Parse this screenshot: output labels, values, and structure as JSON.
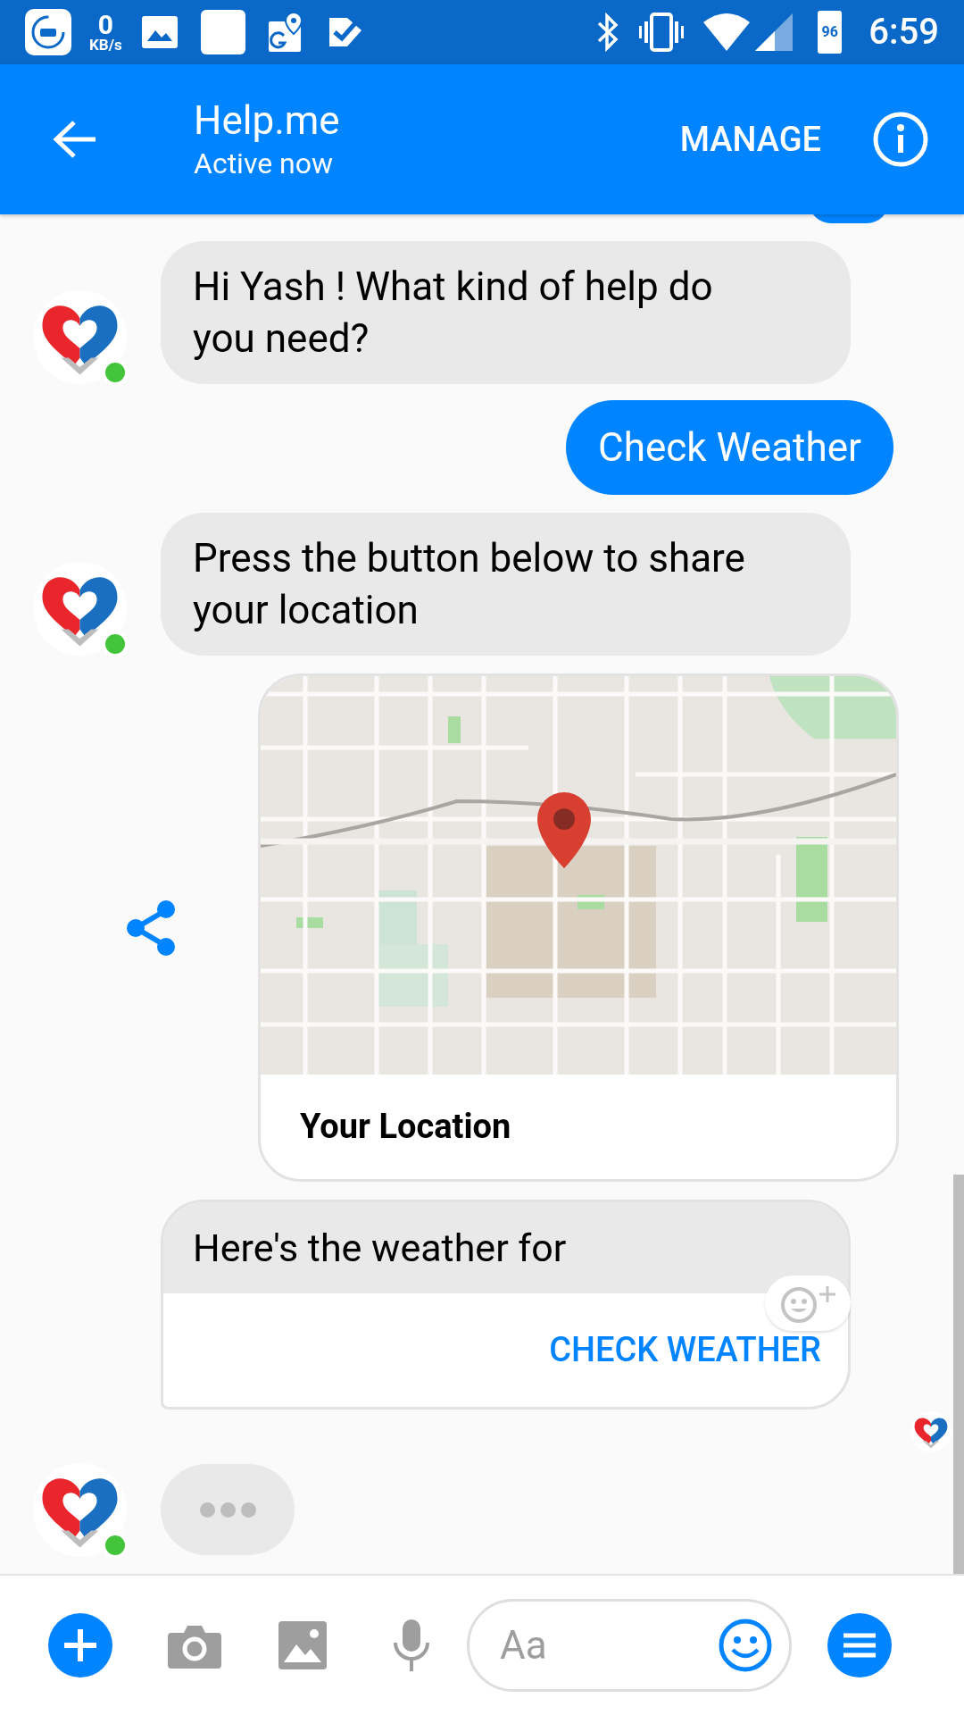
{
  "status_bar": {
    "speed_value": "0",
    "speed_unit": "KB/s",
    "battery": "96",
    "time": "6:59"
  },
  "header": {
    "title": "Help.me",
    "subtitle": "Active now",
    "action": "MANAGE"
  },
  "messages": [
    {
      "kind": "received",
      "avatar": true,
      "online": true,
      "text": "Hi Yash ! What kind of help do you need?"
    },
    {
      "kind": "sent",
      "text": "Check Weather"
    },
    {
      "kind": "received",
      "avatar": true,
      "online": true,
      "text": "Press the button below to share your location"
    },
    {
      "kind": "location",
      "title": "Your Location"
    },
    {
      "kind": "card",
      "text": "Here's the weather for",
      "button": "CHECK WEATHER",
      "seen": true
    },
    {
      "kind": "typing",
      "avatar": true,
      "online": true
    }
  ],
  "composer": {
    "placeholder": "Aa"
  }
}
